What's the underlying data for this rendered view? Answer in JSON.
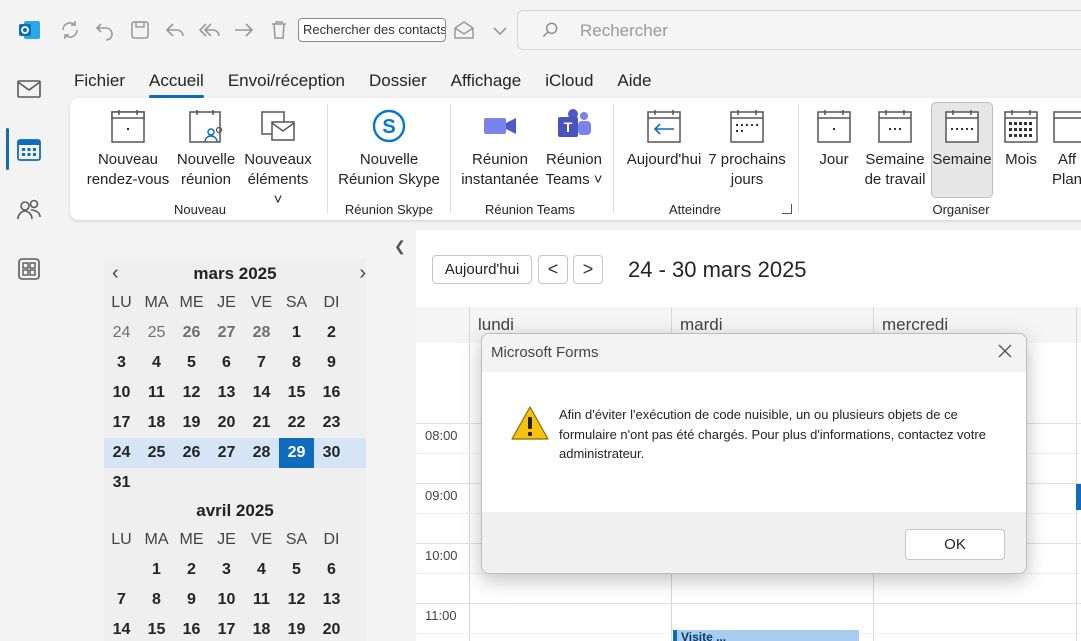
{
  "titlebar": {
    "contact_search_placeholder": "Rechercher des contacts",
    "search_placeholder": "Rechercher"
  },
  "menu": [
    "Fichier",
    "Accueil",
    "Envoi/réception",
    "Dossier",
    "Affichage",
    "iCloud",
    "Aide"
  ],
  "menu_active": "Accueil",
  "ribbon": {
    "new_appointment": [
      "Nouveau",
      "rendez-vous"
    ],
    "new_meeting": [
      "Nouvelle",
      "réunion"
    ],
    "new_items": [
      "Nouveaux",
      "éléments ˅"
    ],
    "group_new": "Nouveau",
    "new_skype": [
      "Nouvelle",
      "Réunion Skype"
    ],
    "group_skype": "Réunion Skype",
    "instant_meeting": [
      "Réunion",
      "instantanée"
    ],
    "teams_meeting": [
      "Réunion",
      "Teams ˅"
    ],
    "group_teams": "Réunion Teams",
    "today": [
      "Aujourd'hui"
    ],
    "next7": [
      "7 prochains",
      "jours"
    ],
    "group_goto": "Atteindre",
    "day": [
      "Jour"
    ],
    "work_week": [
      "Semaine",
      "de travail"
    ],
    "week": [
      "Semaine"
    ],
    "month": [
      "Mois"
    ],
    "schedule": [
      "Aff",
      "Plani"
    ],
    "group_arrange": "Organiser"
  },
  "mini_march": {
    "title": "mars 2025",
    "dow": [
      "LU",
      "MA",
      "ME",
      "JE",
      "VE",
      "SA",
      "DI"
    ],
    "weeks": [
      [
        "24",
        "25",
        "26",
        "27",
        "28",
        "1",
        "2"
      ],
      [
        "3",
        "4",
        "5",
        "6",
        "7",
        "8",
        "9"
      ],
      [
        "10",
        "11",
        "12",
        "13",
        "14",
        "15",
        "16"
      ],
      [
        "17",
        "18",
        "19",
        "20",
        "21",
        "22",
        "23"
      ],
      [
        "24",
        "25",
        "26",
        "27",
        "28",
        "29",
        "30"
      ],
      [
        "31",
        "",
        "",
        "",
        "",
        "",
        ""
      ]
    ]
  },
  "mini_april": {
    "title": "avril 2025",
    "dow": [
      "LU",
      "MA",
      "ME",
      "JE",
      "VE",
      "SA",
      "DI"
    ],
    "weeks": [
      [
        "",
        "1",
        "2",
        "3",
        "4",
        "5",
        "6"
      ],
      [
        "7",
        "8",
        "9",
        "10",
        "11",
        "12",
        "13"
      ],
      [
        "14",
        "15",
        "16",
        "17",
        "18",
        "19",
        "20"
      ]
    ]
  },
  "main": {
    "today_button": "Aujourd'hui",
    "prev": "<",
    "next": ">",
    "range": "24 - 30 mars 2025",
    "days": [
      "lundi",
      "mardi",
      "mercredi"
    ],
    "times": [
      "08:00",
      "09:00",
      "10:00",
      "11:00"
    ],
    "event_text": "Visite ..."
  },
  "dialog": {
    "title": "Microsoft Forms",
    "message": "Afin d'éviter l'exécution de code nuisible, un ou plusieurs objets de ce formulaire n'ont pas été chargés. Pour plus d'informations, contactez votre administrateur.",
    "ok": "OK"
  },
  "colors": {
    "accent": "#0f6cbd",
    "selected_week": "#d5e5f6",
    "warning": "#f5c211"
  }
}
